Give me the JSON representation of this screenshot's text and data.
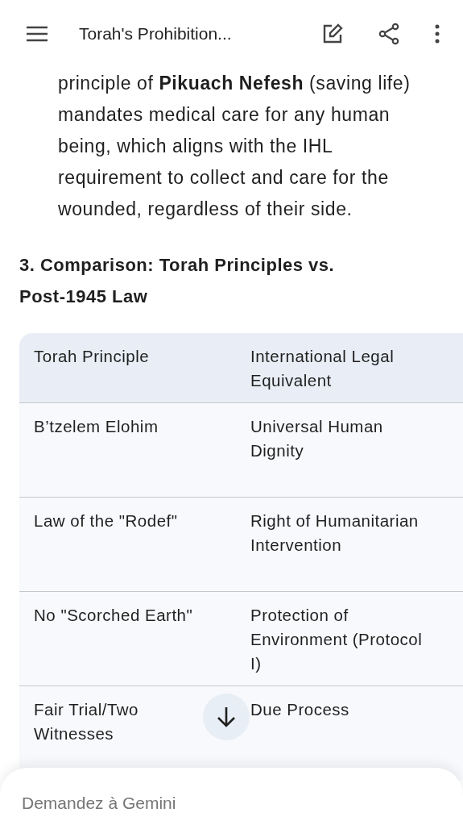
{
  "top_bar": {
    "title": "Torah's Prohibition..."
  },
  "paragraph": "principle of **Pikuach Nefesh** (saving life) mandates medical care for any human being, which aligns with the IHL requirement to collect and care for the wounded, regardless of their side.",
  "heading": "3. Comparison: Torah Principles vs. Post-1945 Law",
  "table": {
    "columns": [
      "Torah Principle",
      "International Legal Equivalent"
    ],
    "rows": [
      [
        "B’tzelem Elohim",
        "Universal Human Dignity"
      ],
      [
        "Law of the \"Rodef\"",
        "Right of Humanitarian Intervention"
      ],
      [
        "No \"Scorched Earth\"",
        "Protection of Environment (Protocol I)"
      ],
      [
        "Fair Trial/Two Witnesses",
        "Due Process"
      ]
    ]
  },
  "prompt": {
    "placeholder": "Demandez à Gemini"
  }
}
